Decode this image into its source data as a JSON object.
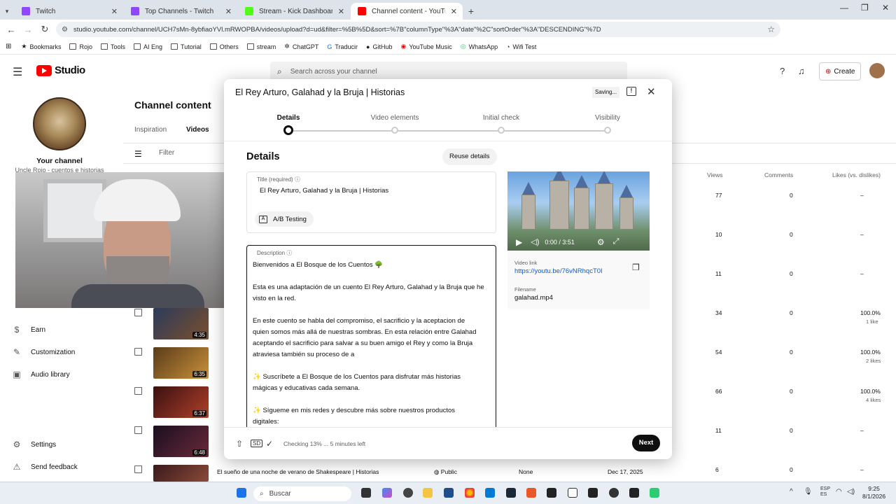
{
  "browser": {
    "tabs": [
      {
        "label": "Twitch",
        "color": "#9146ff",
        "active": false
      },
      {
        "label": "Top Channels - Twitch",
        "color": "#9146ff",
        "active": false
      },
      {
        "label": "Stream - Kick Dashboard",
        "color": "#53fc18",
        "active": false
      },
      {
        "label": "Channel content - YouTube Stu",
        "color": "#ff0000",
        "active": true
      }
    ],
    "url": "studio.youtube.com/channel/UCH7sMn-8ybfiaoYVl.mRWOPBA/videos/upload?d=ud&filter=%5B%5D&sort=%7B\"columnType\"%3A\"date\"%2C\"sortOrder\"%3A\"DESCENDING\"%7D",
    "bookmarks": [
      "Bookmarks",
      "Rojo",
      "Tools",
      "AI Eng",
      "Tutorial",
      "Others",
      "stream",
      "ChatGPT",
      "Traducir",
      "GitHub",
      "YouTube Music",
      "WhatsApp",
      "Wifi Test"
    ]
  },
  "studio": {
    "logo": "Studio",
    "search_placeholder": "Search across your channel",
    "create_label": "Create",
    "channel_label": "Your channel",
    "channel_name": "Uncle Rojo - cuentos e historias",
    "sidebar_items": [
      "Earn",
      "Customization",
      "Audio library",
      "Settings",
      "Send feedback"
    ],
    "content_title": "Channel content",
    "tabs": [
      "Inspiration",
      "Videos"
    ],
    "filter_label": "Filter",
    "columns": [
      "Views",
      "Comments",
      "Likes (vs. dislikes)"
    ],
    "rows": [
      {
        "views": "77",
        "comments": "0",
        "likes": "–",
        "likes_sub": ""
      },
      {
        "views": "10",
        "comments": "0",
        "likes": "–",
        "likes_sub": ""
      },
      {
        "views": "11",
        "comments": "0",
        "likes": "–",
        "likes_sub": ""
      },
      {
        "views": "34",
        "comments": "0",
        "likes": "100.0%",
        "likes_sub": "1 like"
      },
      {
        "views": "54",
        "comments": "0",
        "likes": "100.0%",
        "likes_sub": "2 likes"
      },
      {
        "views": "66",
        "comments": "0",
        "likes": "100.0%",
        "likes_sub": "4 likes"
      },
      {
        "views": "11",
        "comments": "0",
        "likes": "–",
        "likes_sub": ""
      },
      {
        "views": "6",
        "comments": "0",
        "likes": "–",
        "likes_sub": ""
      }
    ],
    "thumb_durations": [
      "4:35",
      "6:35",
      "6:37",
      "6:48"
    ],
    "last_row": {
      "title": "El sueño de una noche de verano de Shakespeare | Historias",
      "visibility": "Public",
      "restrictions": "None",
      "date": "Dec 17, 2025"
    }
  },
  "dialog": {
    "title": "El Rey Arturo, Galahad y la Bruja | Historias",
    "saving": "Saving...",
    "steps": [
      "Details",
      "Video elements",
      "Initial check",
      "Visibility"
    ],
    "section": "Details",
    "reuse_label": "Reuse details",
    "title_label": "Title (required)",
    "title_value": "El Rey Arturo, Galahad y la Bruja | Historias",
    "ab_label": "A/B Testing",
    "desc_label": "Description",
    "desc_lines": [
      "Bienvenidos a El Bosque de los Cuentos 🌳",
      "",
      "Esta es una adaptación de un cuento El Rey Arturo, Galahad y la Bruja que he",
      "visto en la red.",
      "",
      "En este cuento se habla del compromiso, el sacrificio y la aceptacion de",
      "quien somos más allá de nuestras sombras. En esta relación entre Galahad",
      "aceptando el sacrificio para salvar a su buen amigo el Rey y como la Bruja",
      "atraviesa también su proceso de a",
      "",
      "✨ Suscríbete a El Bosque de los Cuentos para disfrutar más historias",
      "mágicas y educativas cada semana.",
      "",
      "✨ Sígueme en mis redes y descubre más sobre nuestros productos",
      "digitales:"
    ],
    "video_time": "0:00 / 3:51",
    "video_link_label": "Video link",
    "video_link": "https://youtu.be/76vNRhqcT0I",
    "filename_label": "Filename",
    "filename": "galahad.mp4",
    "checking": "Checking 13% ... 5 minutes left",
    "next_label": "Next"
  },
  "taskbar": {
    "search": "Buscar",
    "lang": "ESP\nES",
    "time": "9:25",
    "date": "8/1/2026"
  }
}
